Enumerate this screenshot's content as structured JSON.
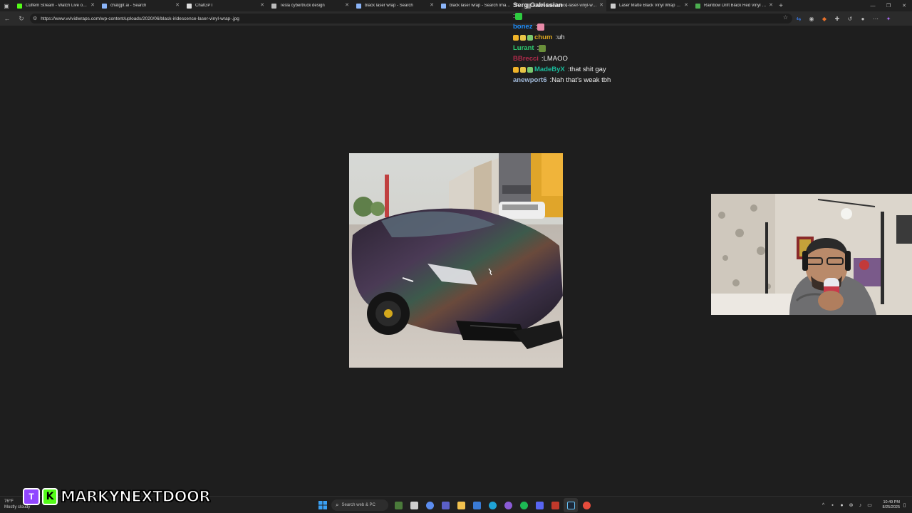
{
  "browser": {
    "tabs": [
      {
        "title": "Cuffem Stream - Watch Live on Kick",
        "favicon": "kick-icon",
        "color": "#53fc18"
      },
      {
        "title": "chatgpt ai - Search",
        "favicon": "search-icon",
        "color": "#8ab4f8"
      },
      {
        "title": "ChatGPT",
        "favicon": "chatgpt-icon",
        "color": "#dddddd"
      },
      {
        "title": "Tesla cybertruck design",
        "favicon": "globe-icon",
        "color": "#bbbbbb"
      },
      {
        "title": "black laser wrap - Search",
        "favicon": "search-icon",
        "color": "#8ab4f8"
      },
      {
        "title": "black laser wrap - Search Images",
        "favicon": "search-icon",
        "color": "#8ab4f8"
      },
      {
        "title": "black-iridescence-laser-vinyl-wrap",
        "favicon": "image-icon",
        "color": "#888888"
      },
      {
        "title": "Laser Matte Black Vinyl Wrap – C",
        "favicon": "store-icon",
        "color": "#cccccc"
      },
      {
        "title": "Rainbow Drift Black Red Vinyl Wrap",
        "favicon": "leaf-icon",
        "color": "#4caf50"
      }
    ],
    "active_tab_index": 6,
    "url": "https://www.vvividwraps.com/wp-content/uploads/2020/06/black-iridescence-laser-vinyl-wrap-.jpg"
  },
  "chat": {
    "messages": [
      {
        "user": "Serg Galrissian",
        "message": "",
        "user_color": "#e0e0e0",
        "emote": "",
        "badges": []
      },
      {
        "user": "",
        "message": "",
        "user_color": "#d9163d",
        "emote": "green-e",
        "badges": []
      },
      {
        "user": "bonez",
        "message": "",
        "user_color": "#1e90ff",
        "emote": "pink-square",
        "badges": []
      },
      {
        "user": "chum",
        "message": "uh",
        "user_color": "#daa520",
        "emote": "",
        "badges": [
          "crown",
          "gift",
          "leaf"
        ]
      },
      {
        "user": "Lurant",
        "message": "",
        "user_color": "#2ecc71",
        "emote": "pepe",
        "badges": []
      },
      {
        "user": "BBrecci",
        "message": "LMAOO",
        "user_color": "#b22b4b",
        "emote": "",
        "badges": []
      },
      {
        "user": "MadeByX",
        "message": "that shit gay",
        "user_color": "#1abc9c",
        "emote": "",
        "badges": [
          "crown",
          "gift",
          "leaf"
        ]
      },
      {
        "user": "anewport6",
        "message": "Nah that's weak tbh",
        "user_color": "#9fb7d6",
        "emote": "",
        "badges": []
      }
    ]
  },
  "watermark": {
    "twitch_glyph": "T",
    "kick_glyph": "K",
    "channel_name": "MARKYNEXTDOOR"
  },
  "taskbar": {
    "weather_line1": "76°F",
    "weather_line2": "Mostly cloudy",
    "search_placeholder": "Search web & PC",
    "time": "10:49 PM",
    "date": "8/25/2025"
  },
  "colors": {
    "kick_green": "#53fc18",
    "twitch_purple": "#9146ff",
    "page_bg": "#1e1e1e"
  }
}
